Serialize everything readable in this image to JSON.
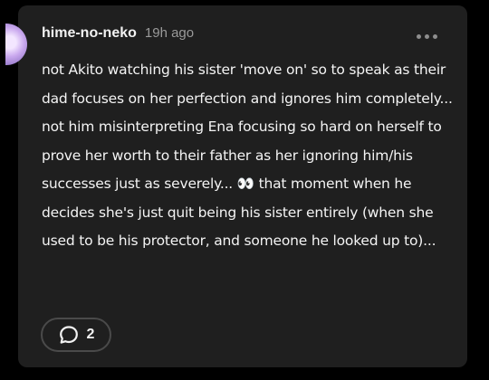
{
  "post": {
    "username": "hime-no-neko",
    "timestamp": "19h ago",
    "text": "not Akito watching his sister 'move on' so to speak as their dad focuses on her perfection and ignores him completely... not him misinterpreting Ena focusing so hard on herself to prove her worth to their father as her ignoring him/his successes just as severely... 👀 that moment when he decides she's just quit being his sister entirely (when she used to be his protector, and someone he looked up to)...",
    "reply_count": "2"
  },
  "icons": {
    "more": "more-horizontal-icon",
    "reply": "speech-bubble-icon"
  },
  "colors": {
    "background": "#000000",
    "card": "#1f1f1f",
    "text": "#f4f4f4",
    "muted": "#9a9a9a"
  }
}
